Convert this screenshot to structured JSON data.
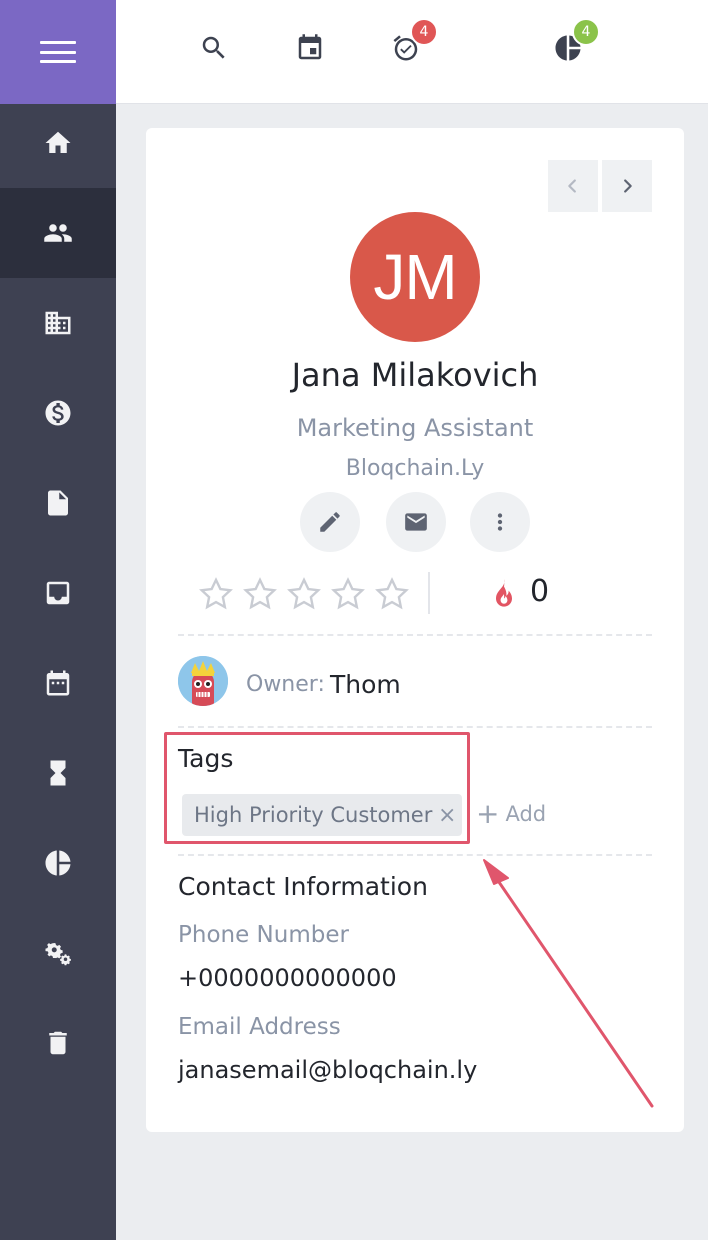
{
  "topbar": {
    "alarm_badge": "4",
    "stats_badge": "4"
  },
  "contact": {
    "initials": "JM",
    "name": "Jana Milakovich",
    "job_title": "Marketing Assistant",
    "company": "Bloqchain.Ly",
    "rating_stars_filled": 0,
    "rating_stars_total": 5,
    "hotness": "0"
  },
  "owner": {
    "label": "Owner:",
    "name": "Thom"
  },
  "tags": {
    "heading": "Tags",
    "items": [
      "High Priority Customer"
    ],
    "remove_glyph": "×",
    "add_label": "Add"
  },
  "contact_info": {
    "heading": "Contact Information",
    "phone_label": "Phone Number",
    "phone_value": "+0000000000000",
    "email_label": "Email Address",
    "email_value": "janasemail@bloqchain.ly"
  },
  "colors": {
    "sidebar": "#3e4152",
    "sidebar_active": "#2c2f3d",
    "menu_header": "#7b68c4",
    "avatar": "#d9584a",
    "annotation": "#e0566c",
    "badge_red": "#e05656",
    "badge_green": "#8bc34a"
  }
}
